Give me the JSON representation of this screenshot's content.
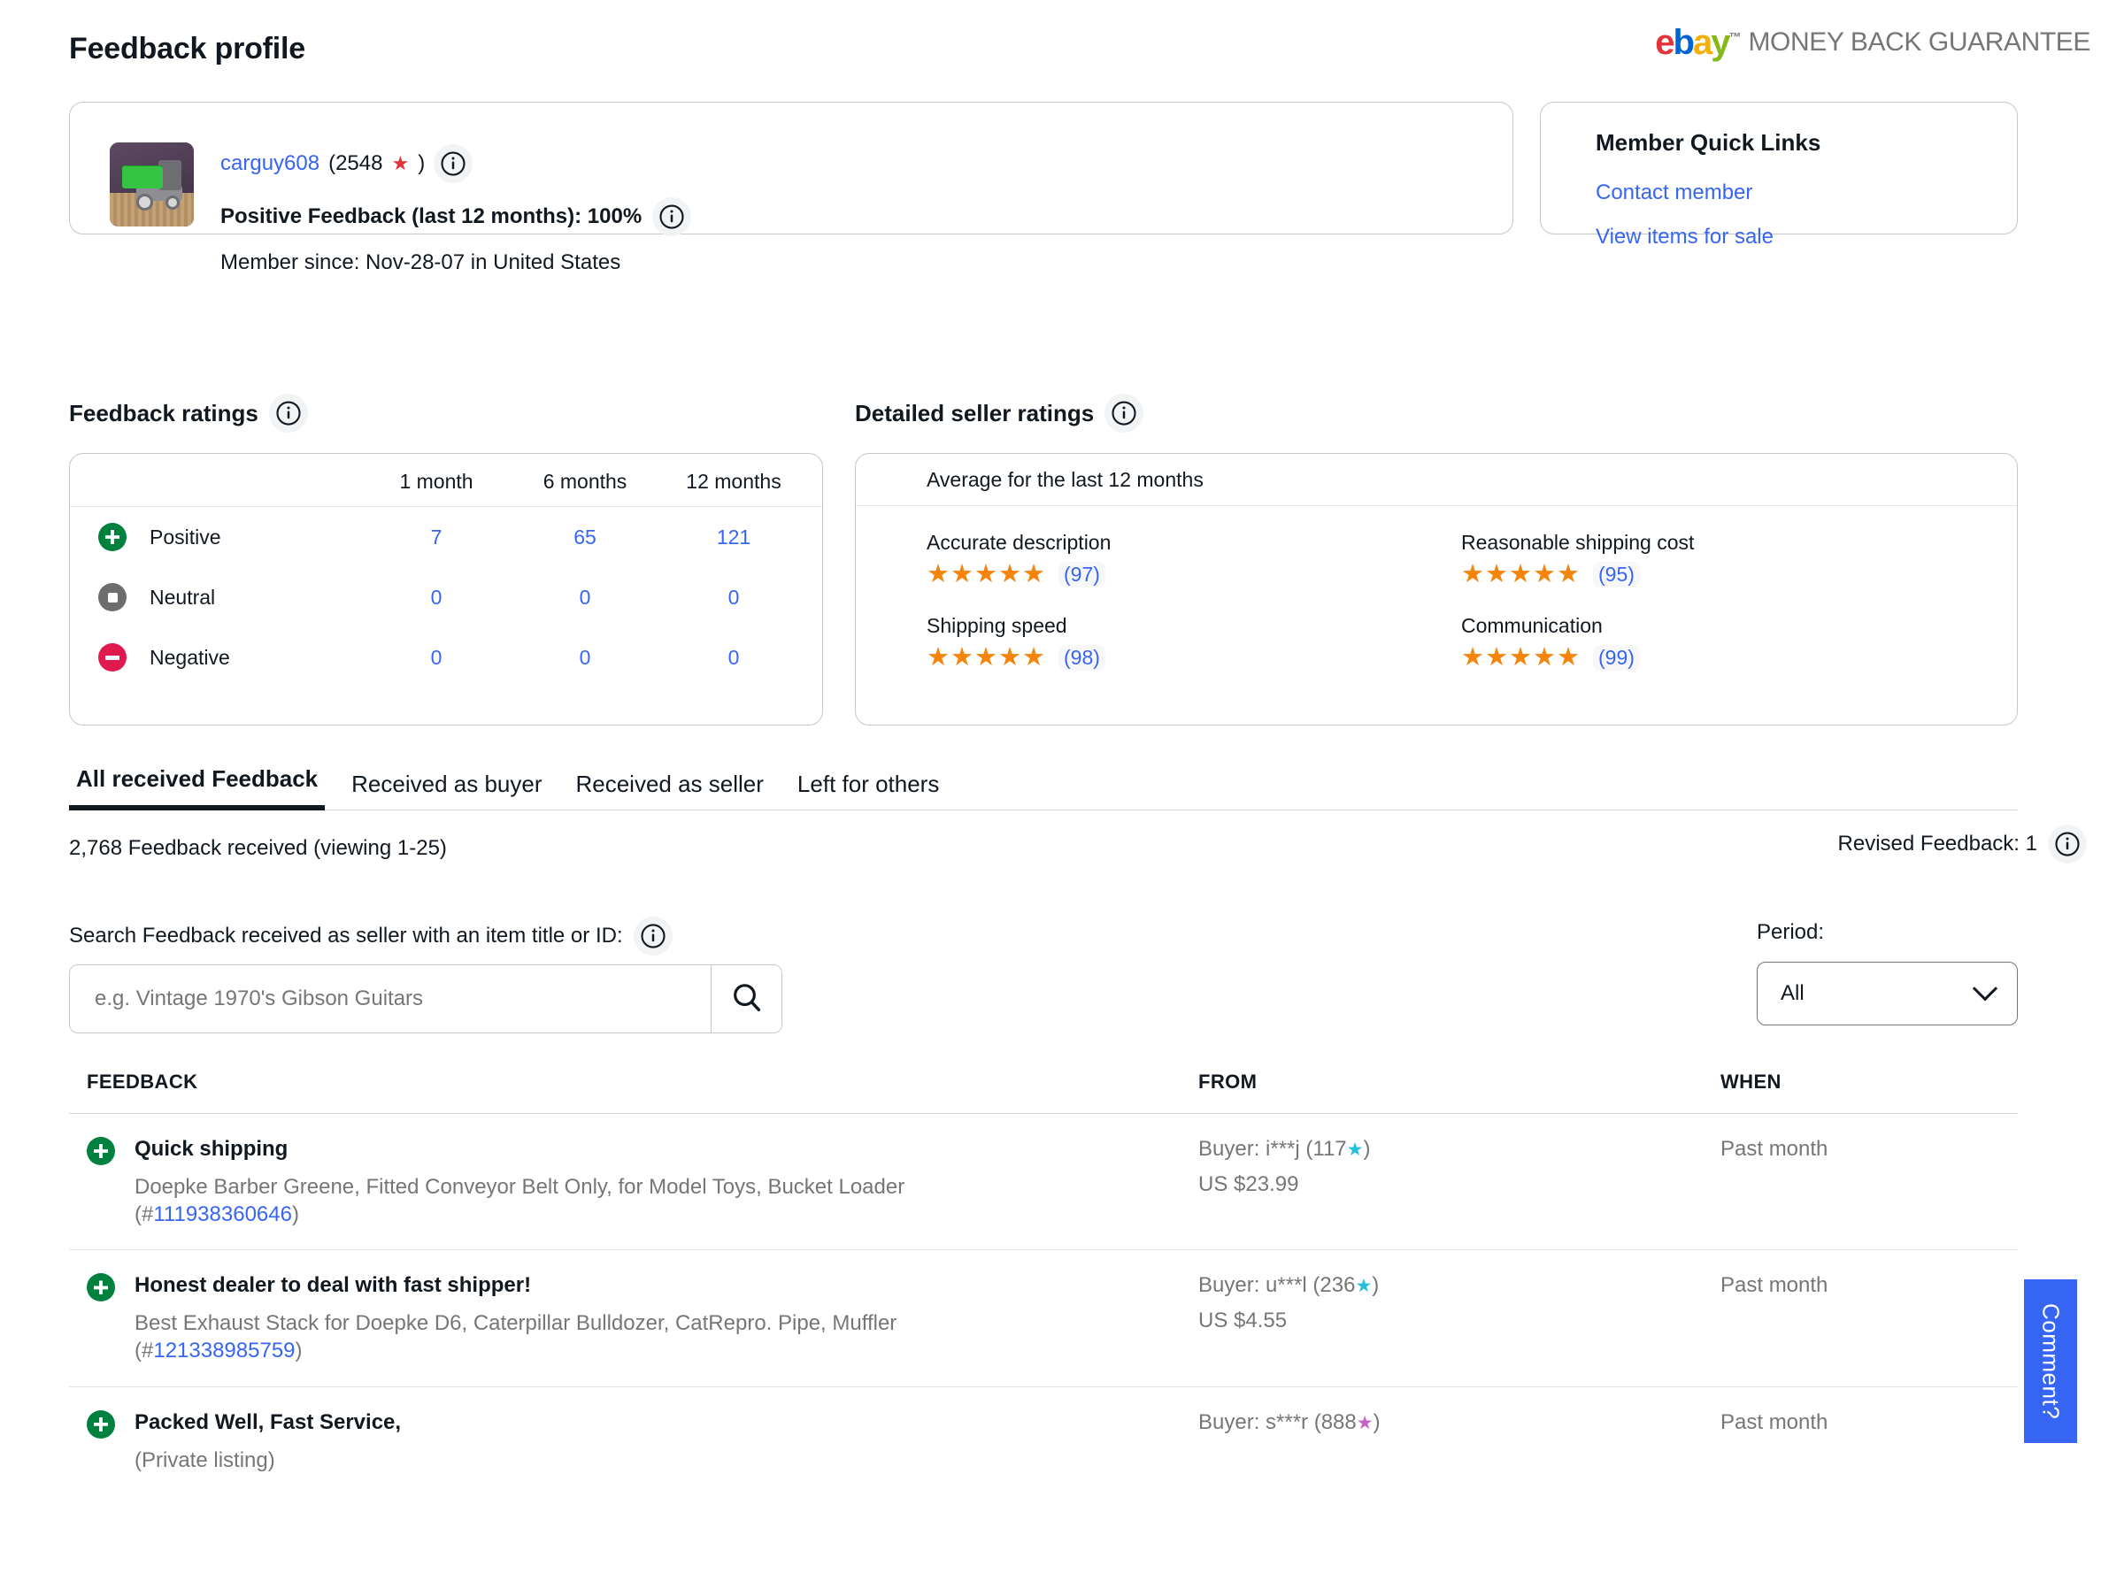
{
  "header": {
    "title": "Feedback profile",
    "mbg_brand": "ebay",
    "mbg_text": "MONEY BACK GUARANTEE"
  },
  "seller": {
    "username": "carguy608",
    "feedback_score_open": "(2548",
    "feedback_score_close": ")",
    "star_icon": "red-star-icon",
    "positive_feedback": "Positive Feedback (last 12 months): 100%",
    "member_since": "Member since: Nov-28-07 in United States"
  },
  "quick_links": {
    "title": "Member Quick Links",
    "items": [
      {
        "label": "Contact member"
      },
      {
        "label": "View items for sale"
      }
    ]
  },
  "feedback_ratings": {
    "heading": "Feedback ratings",
    "columns": [
      "1 month",
      "6 months",
      "12 months"
    ],
    "rows": [
      {
        "label": "Positive",
        "values": [
          "7",
          "65",
          "121"
        ]
      },
      {
        "label": "Neutral",
        "values": [
          "0",
          "0",
          "0"
        ]
      },
      {
        "label": "Negative",
        "values": [
          "0",
          "0",
          "0"
        ]
      }
    ]
  },
  "detailed_seller_ratings": {
    "heading": "Detailed seller ratings",
    "subtitle": "Average for the last 12 months",
    "items": [
      {
        "label": "Accurate description",
        "stars": "★★★★★",
        "count": "(97)"
      },
      {
        "label": "Reasonable shipping cost",
        "stars": "★★★★★",
        "count": "(95)"
      },
      {
        "label": "Shipping speed",
        "stars": "★★★★★",
        "count": "(98)"
      },
      {
        "label": "Communication",
        "stars": "★★★★★",
        "count": "(99)"
      }
    ]
  },
  "tabs": [
    {
      "label": "All received Feedback",
      "active": true
    },
    {
      "label": "Received as buyer",
      "active": false
    },
    {
      "label": "Received as seller",
      "active": false
    },
    {
      "label": "Left for others",
      "active": false
    }
  ],
  "summary": {
    "count_text": "2,768 Feedback received (viewing 1-25)",
    "revised_text": "Revised Feedback: 1"
  },
  "search": {
    "label": "Search Feedback received as seller with an item title or ID:",
    "placeholder": "e.g. Vintage 1970's Gibson Guitars",
    "value": "",
    "button_icon": "search-icon"
  },
  "period": {
    "label": "Period:",
    "selected": "All"
  },
  "feedback_table": {
    "columns": {
      "feedback": "FEEDBACK",
      "from": "FROM",
      "when": "WHEN"
    },
    "rows": [
      {
        "rating_icon": "positive-icon",
        "title": "Quick shipping",
        "item": "Doepke Barber Greene, Fitted Conveyor Belt Only, for Model Toys, Bucket Loader",
        "item_id_prefix": "(#",
        "item_id": "111938360646",
        "item_id_suffix": ")",
        "buyer": "Buyer: i***j (117",
        "buyer_star": "★",
        "buyer_star_color": "#22bfe0",
        "buyer_close": ")",
        "price": "US $23.99",
        "when": "Past month"
      },
      {
        "rating_icon": "positive-icon",
        "title": "Honest dealer to deal with fast shipper!",
        "item": "Best Exhaust Stack for Doepke D6, Caterpillar Bulldozer, CatRepro. Pipe, Muffler",
        "item_id_prefix": "(#",
        "item_id": "121338985759",
        "item_id_suffix": ")",
        "buyer": "Buyer: u***l (236",
        "buyer_star": "★",
        "buyer_star_color": "#22bfe0",
        "buyer_close": ")",
        "price": "US $4.55",
        "when": "Past month"
      },
      {
        "rating_icon": "positive-icon",
        "title": "Packed Well, Fast Service,",
        "item": "(Private listing)",
        "item_id_prefix": "",
        "item_id": "",
        "item_id_suffix": "",
        "buyer": "Buyer: s***r (888",
        "buyer_star": "★",
        "buyer_star_color": "#c661c6",
        "buyer_close": ")",
        "price": "",
        "when": "Past month"
      }
    ]
  },
  "comment_tab": {
    "label": "Comment?"
  },
  "colors": {
    "link": "#3665f3",
    "positive": "#00823e",
    "neutral": "#6d6d6d",
    "negative": "#e01a4f",
    "star_orange": "#f5840a",
    "star_red": "#e53238",
    "comment_blue": "#3665f3"
  }
}
